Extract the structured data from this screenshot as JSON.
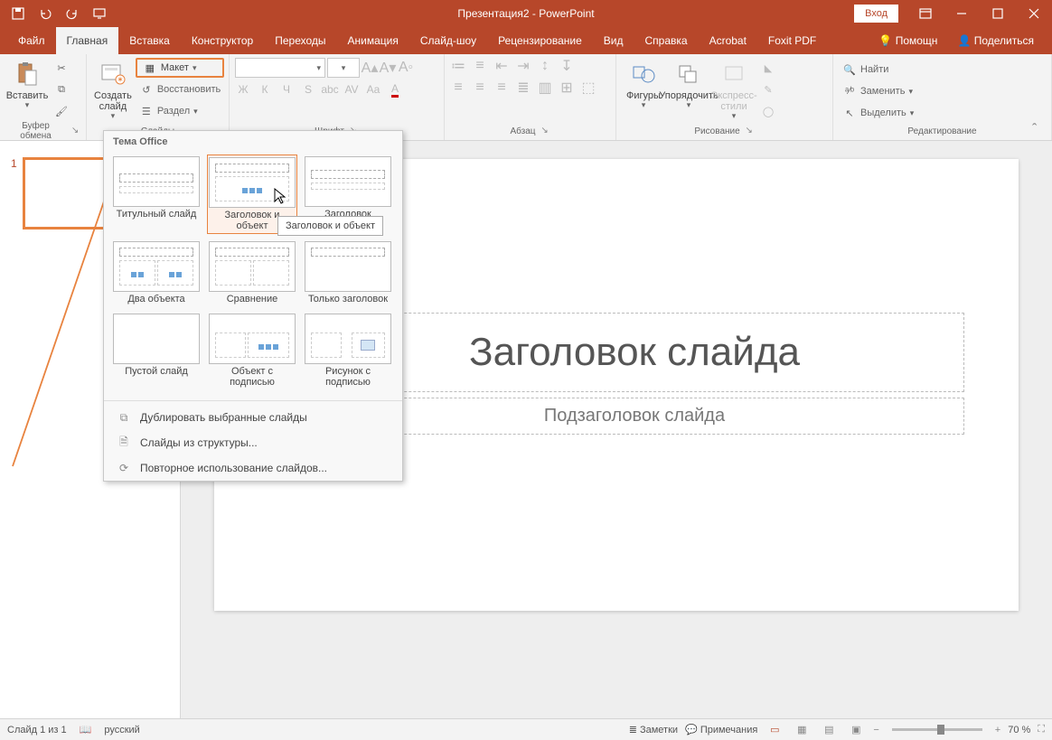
{
  "titlebar": {
    "title": "Презентация2 - PowerPoint",
    "login": "Вход"
  },
  "tabs": {
    "items": [
      "Файл",
      "Главная",
      "Вставка",
      "Конструктор",
      "Переходы",
      "Анимация",
      "Слайд-шоу",
      "Рецензирование",
      "Вид",
      "Справка",
      "Acrobat",
      "Foxit PDF"
    ],
    "active_index": 1,
    "help": "Помощн",
    "share": "Поделиться"
  },
  "ribbon": {
    "clipboard": {
      "paste": "Вставить",
      "label": "Буфер обмена"
    },
    "slides": {
      "new_slide": "Создать\nслайд",
      "layout": "Макет",
      "reset": "Восстановить",
      "section": "Раздел",
      "label": "Слайды"
    },
    "font": {
      "label": "Шрифт",
      "btns": [
        "Ж",
        "К",
        "Ч",
        "S",
        "abc",
        "AV",
        "Aa"
      ]
    },
    "paragraph": {
      "label": "Абзац"
    },
    "drawing": {
      "shapes": "Фигуры",
      "arrange": "Упорядочить",
      "quickstyles": "Экспресс-\nстили",
      "label": "Рисование"
    },
    "editing": {
      "find": "Найти",
      "replace": "Заменить",
      "select": "Выделить",
      "label": "Редактирование"
    }
  },
  "gallery": {
    "header": "Тема Office",
    "items": [
      {
        "label": "Титульный слайд",
        "type": "title"
      },
      {
        "label": "Заголовок и объект",
        "type": "content",
        "hover": true
      },
      {
        "label": "Заголовок раздела",
        "type": "section"
      },
      {
        "label": "Два объекта",
        "type": "two"
      },
      {
        "label": "Сравнение",
        "type": "compare"
      },
      {
        "label": "Только заголовок",
        "type": "onlytitle"
      },
      {
        "label": "Пустой слайд",
        "type": "blank"
      },
      {
        "label": "Объект с подписью",
        "type": "objcap"
      },
      {
        "label": "Рисунок с подписью",
        "type": "piccap"
      }
    ],
    "tooltip": "Заголовок и объект",
    "menu": [
      "Дублировать выбранные слайды",
      "Слайды из структуры...",
      "Повторное использование слайдов..."
    ]
  },
  "slide": {
    "title_ph": "Заголовок слайда",
    "sub_ph": "Подзаголовок слайда"
  },
  "status": {
    "slide_pos": "Слайд 1 из 1",
    "lang": "русский",
    "notes": "Заметки",
    "comments": "Примечания",
    "zoom": "70 %"
  },
  "thumbnail": {
    "number": "1"
  }
}
